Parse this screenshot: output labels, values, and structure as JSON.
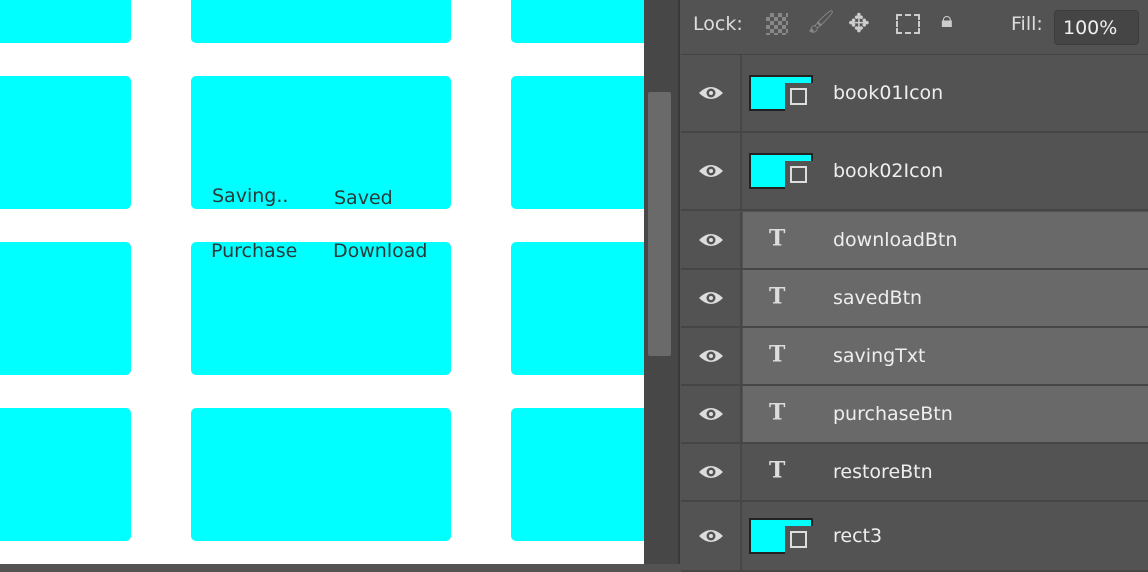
{
  "canvas": {
    "texts": {
      "saving": "Saving..",
      "saved": "Saved",
      "purchase": "Purchase",
      "download": "Download"
    },
    "fill_color": "#00ffff"
  },
  "panel": {
    "lock_label": "Lock:",
    "fill_label": "Fill:",
    "fill_value": "100%",
    "layers": [
      {
        "name": "book01Icon",
        "type": "shape",
        "visible": true,
        "selected": false
      },
      {
        "name": "book02Icon",
        "type": "shape",
        "visible": true,
        "selected": false
      },
      {
        "name": "downloadBtn",
        "type": "text",
        "visible": true,
        "selected": true
      },
      {
        "name": "savedBtn",
        "type": "text",
        "visible": true,
        "selected": true
      },
      {
        "name": "savingTxt",
        "type": "text",
        "visible": true,
        "selected": true
      },
      {
        "name": "purchaseBtn",
        "type": "text",
        "visible": true,
        "selected": true
      },
      {
        "name": "restoreBtn",
        "type": "text",
        "visible": true,
        "selected": false
      },
      {
        "name": "rect3",
        "type": "shape",
        "visible": true,
        "selected": false
      }
    ],
    "text_layer_glyph": "T"
  }
}
